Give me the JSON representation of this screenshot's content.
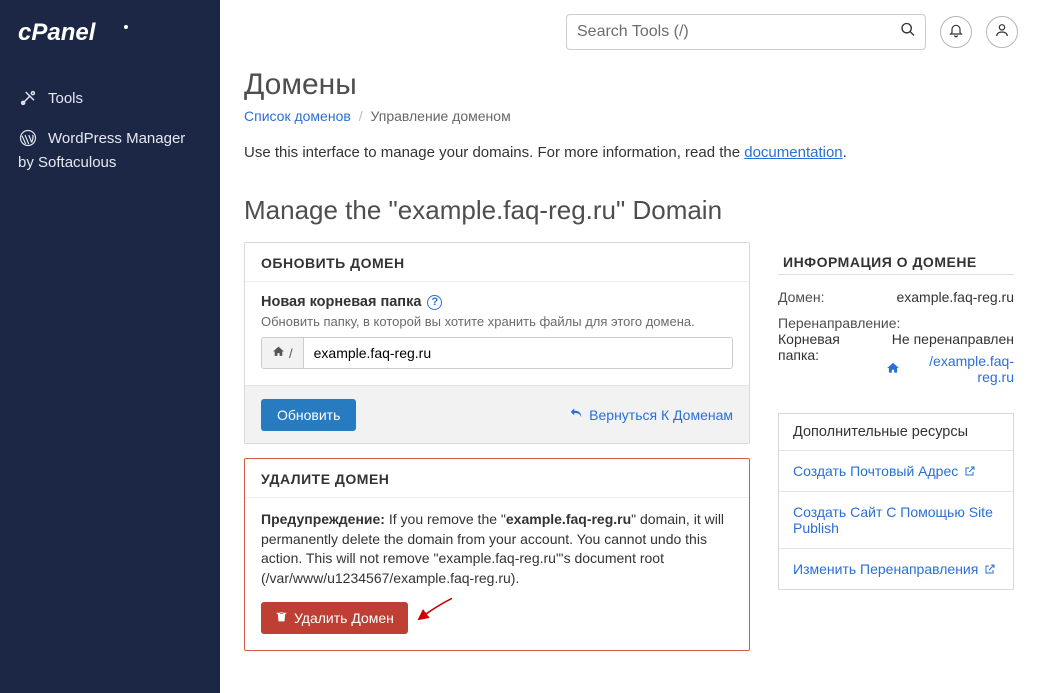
{
  "sidebar": {
    "items": [
      {
        "label": "Tools"
      },
      {
        "label_line1": "WordPress Manager",
        "label_line2": "by Softaculous"
      }
    ]
  },
  "topbar": {
    "search_placeholder": "Search Tools (/)"
  },
  "page": {
    "title": "Домены",
    "breadcrumb_domains": "Список доменов",
    "breadcrumb_current": "Управление доменом",
    "intro_pre": "Use this interface to manage your domains. For more information, read the ",
    "intro_link": "documentation",
    "intro_post": ".",
    "manage_heading": "Manage the \"example.faq-reg.ru\" Domain"
  },
  "update_panel": {
    "heading": "ОБНОВИТЬ ДОМЕН",
    "field_label": "Новая корневая папка",
    "field_desc": "Обновить папку, в которой вы хотите хранить файлы для этого домена.",
    "prefix_text": "/",
    "input_value": "example.faq-reg.ru",
    "btn_update": "Обновить",
    "btn_back": "Вернуться К Доменам"
  },
  "remove_panel": {
    "heading": "УДАЛИТЕ ДОМЕН",
    "warn_label": "Предупреждение:",
    "warn_text_1": " If you remove the \"",
    "warn_domain": "example.faq-reg.ru",
    "warn_text_2": "\" domain, it will permanently delete the domain from your account. You cannot undo this action. This will not remove \"example.faq-reg.ru\"'s document root (/var/www/u1234567/example.faq-reg.ru).",
    "btn_remove": "Удалить Домен"
  },
  "info": {
    "heading": "ИНФОРМАЦИЯ О ДОМЕНЕ",
    "domain_label": "Домен:",
    "domain_value": "example.faq-reg.ru",
    "redirect_label": "Перенаправление:",
    "redirect_value": "Не перенаправлен",
    "root_label": "Корневая папка:",
    "root_link": "/example.faq-reg.ru"
  },
  "resources": {
    "heading": "Дополнительные ресурсы",
    "items": [
      {
        "label": "Создать Почтовый Адрес"
      },
      {
        "label": "Создать Сайт С Помощью Site Publish"
      },
      {
        "label": "Изменить Перенаправления"
      }
    ]
  }
}
